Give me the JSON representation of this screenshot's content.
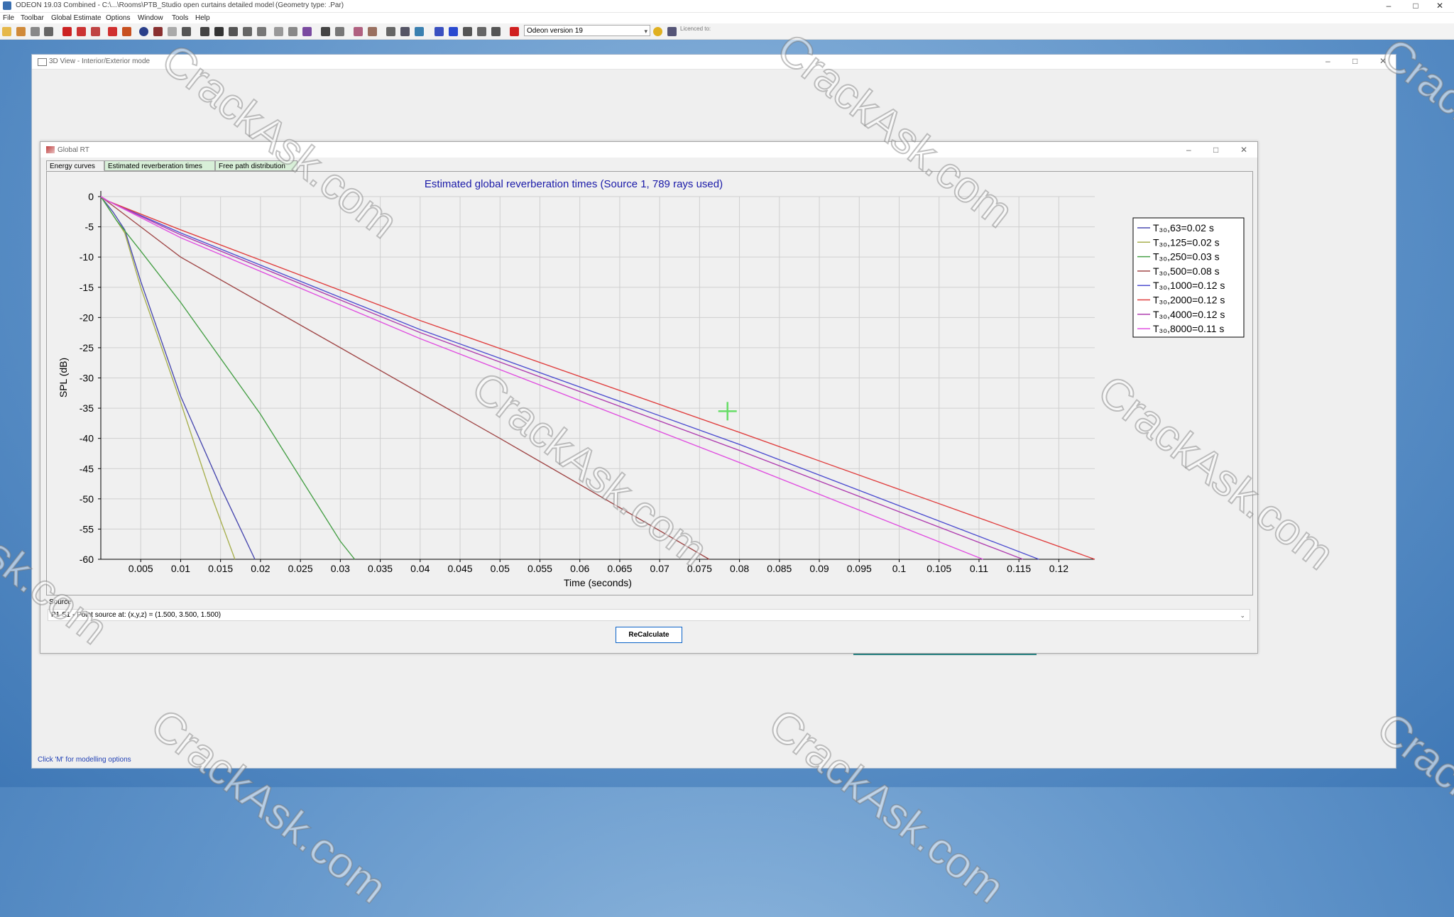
{
  "app": {
    "title": "ODEON 19.03 Combined  -  C:\\...\\Rooms\\PTB_Studio open curtains detailed model",
    "geometry_type": "(Geometry type: .Par)"
  },
  "menu": [
    "File",
    "Toolbar",
    "Global Estimate",
    "Options",
    "Window",
    "Tools",
    "Help"
  ],
  "toolbar": {
    "version_select": "Odeon version 19",
    "licence": "Licenced to:"
  },
  "view3d": {
    "title": "3D View - Interior/Exterior mode",
    "hint": "Click 'M' for modelling options"
  },
  "rt_window": {
    "title": "Global RT",
    "tabs": [
      "Energy  curves",
      "Estimated reverberation times",
      "Free path distribution"
    ],
    "source_label": "Source",
    "source_value": "P1 S1  -  Point source at: (x,y,z) = (1.500, 3.500, 1.500)",
    "recalc_label": "ReCalculate"
  },
  "watermark": "CrackAsk.com",
  "chart_data": {
    "type": "line",
    "title": "Estimated global reverberation times (Source 1, 789 rays used)",
    "xlabel": "Time (seconds)",
    "ylabel": "SPL (dB)",
    "xlim": [
      0,
      0.1245
    ],
    "ylim": [
      -60,
      0
    ],
    "xticks": [
      0.005,
      0.01,
      0.015,
      0.02,
      0.025,
      0.03,
      0.035,
      0.04,
      0.045,
      0.05,
      0.055,
      0.06,
      0.065,
      0.07,
      0.075,
      0.08,
      0.085,
      0.09,
      0.095,
      0.1,
      0.105,
      0.11,
      0.115,
      0.12
    ],
    "xtick_labels": [
      "0.005",
      "0.01",
      "0.015",
      "0.02",
      "0.025",
      "0.03",
      "0.035",
      "0.04",
      "0.045",
      "0.05",
      "0.055",
      "0.06",
      "0.065",
      "0.07",
      "0.075",
      "0.08",
      "0.085",
      "0.09",
      "0.095",
      "0.1",
      "0.105",
      "0.11",
      "0.115",
      "0.12"
    ],
    "yticks": [
      0,
      -5,
      -10,
      -15,
      -20,
      -25,
      -30,
      -35,
      -40,
      -45,
      -50,
      -55,
      -60
    ],
    "ytick_labels": [
      "0",
      "-5",
      "-10",
      "-15",
      "-20",
      "-25",
      "-30",
      "-35",
      "-40",
      "-45",
      "-50",
      "-55",
      "-60"
    ],
    "grid": true,
    "legend_position": "top-right",
    "series": [
      {
        "name": "T₃₀,63=0.02 s",
        "color": "#4b4bb0",
        "x": [
          0,
          0.0015,
          0.003,
          0.005,
          0.01,
          0.015,
          0.0193
        ],
        "y": [
          0,
          -2.5,
          -5.5,
          -14,
          -33,
          -48,
          -60
        ]
      },
      {
        "name": "T₃₀,125=0.02 s",
        "color": "#a8b050",
        "x": [
          0,
          0.0015,
          0.003,
          0.005,
          0.01,
          0.014,
          0.0168
        ],
        "y": [
          0,
          -3,
          -6,
          -15,
          -34,
          -50,
          -60
        ]
      },
      {
        "name": "T₃₀,250=0.03 s",
        "color": "#48a048",
        "x": [
          0,
          0.002,
          0.005,
          0.01,
          0.02,
          0.03,
          0.0318
        ],
        "y": [
          0,
          -4,
          -9,
          -17.5,
          -36,
          -57,
          -60
        ]
      },
      {
        "name": "T₃₀,500=0.08 s",
        "color": "#a04848",
        "x": [
          0,
          0.002,
          0.01,
          0.03,
          0.05,
          0.0762
        ],
        "y": [
          0,
          -2,
          -10,
          -25,
          -40,
          -60
        ]
      },
      {
        "name": "T₃₀,1000=0.12 s",
        "color": "#4f4fd0",
        "x": [
          0,
          0.001,
          0.01,
          0.04,
          0.08,
          0.1175
        ],
        "y": [
          0,
          -0.8,
          -6,
          -22,
          -41,
          -60
        ]
      },
      {
        "name": "T₃₀,2000=0.12 s",
        "color": "#e04040",
        "x": [
          0,
          0.001,
          0.01,
          0.04,
          0.08,
          0.1245
        ],
        "y": [
          0,
          -0.8,
          -5.5,
          -20.5,
          -39,
          -60
        ]
      },
      {
        "name": "T₃₀,4000=0.12 s",
        "color": "#b040b0",
        "x": [
          0,
          0.001,
          0.01,
          0.04,
          0.08,
          0.1155
        ],
        "y": [
          0,
          -0.8,
          -6.3,
          -22.5,
          -42,
          -60
        ]
      },
      {
        "name": "T₃₀,8000=0.11 s",
        "color": "#e050e0",
        "x": [
          0,
          0.001,
          0.01,
          0.04,
          0.08,
          0.1105
        ],
        "y": [
          0,
          -0.8,
          -6.8,
          -23.5,
          -44,
          -60
        ]
      }
    ],
    "marker": {
      "x": 0.0785,
      "y": -35.5,
      "color": "#66dd66"
    }
  }
}
